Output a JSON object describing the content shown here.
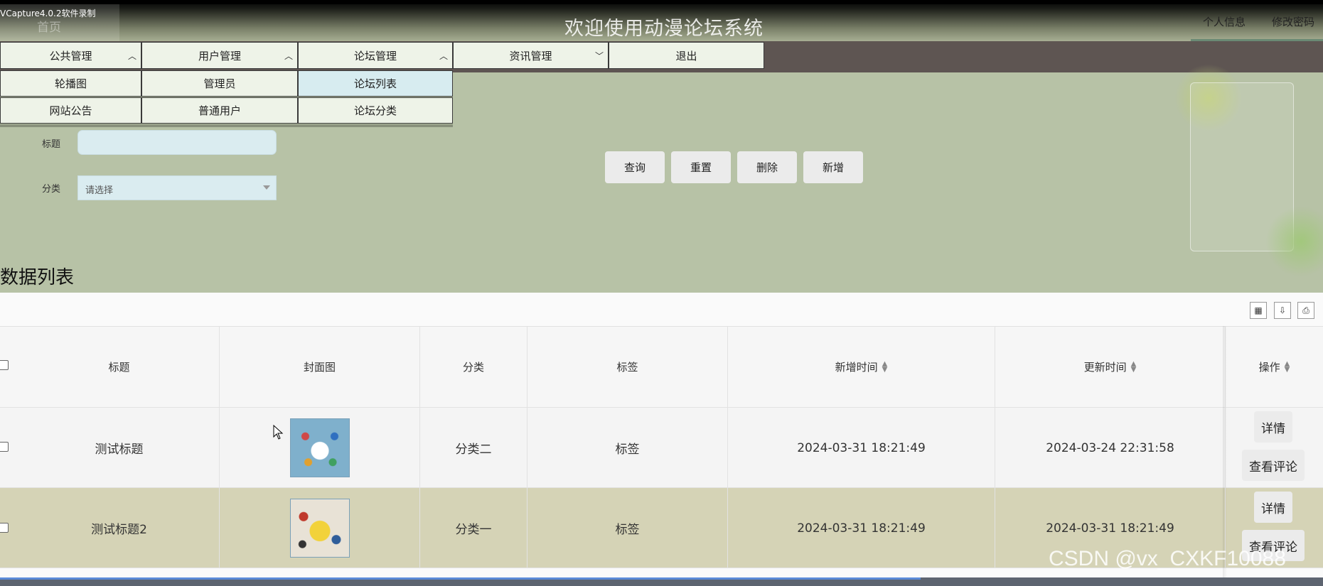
{
  "capture_label": "VCapture4.0.2软件录制",
  "header": {
    "home_ghost": "首页",
    "title": "欢迎使用动漫论坛系统",
    "links": [
      "个人信息",
      "修改密码"
    ]
  },
  "menu": {
    "main": [
      "公共管理",
      "用户管理",
      "论坛管理",
      "资讯管理",
      "退出"
    ],
    "sub_public": [
      "轮播图",
      "网站公告"
    ],
    "sub_users": [
      "管理员",
      "普通用户"
    ],
    "sub_forum": [
      "论坛列表",
      "论坛分类"
    ]
  },
  "search": {
    "title_label": "标题",
    "category_label": "分类",
    "category_placeholder": "请选择",
    "buttons": [
      "查询",
      "重置",
      "删除",
      "新增"
    ]
  },
  "section_title": "数据列表",
  "toolbar_icons": [
    "columns-icon",
    "export-icon",
    "print-icon"
  ],
  "table": {
    "headers": [
      "标题",
      "封面图",
      "分类",
      "标签",
      "新增时间",
      "更新时间",
      "操作"
    ],
    "rows": [
      {
        "title": "测试标题",
        "category": "分类二",
        "tag": "标签",
        "created": "2024-03-31 18:21:49",
        "updated": "2024-03-24 22:31:58"
      },
      {
        "title": "测试标题2",
        "category": "分类一",
        "tag": "标签",
        "created": "2024-03-31 18:21:49",
        "updated": "2024-03-31 18:21:49"
      }
    ],
    "actions": [
      "详情",
      "查看评论"
    ]
  },
  "watermark": "CSDN @vx_CXKF10088"
}
